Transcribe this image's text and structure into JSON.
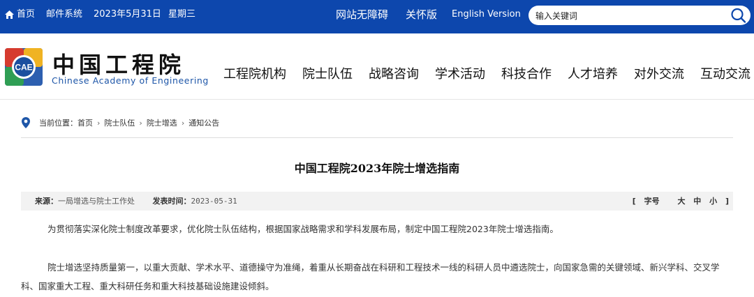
{
  "topbar": {
    "home": "首页",
    "mail": "邮件系统",
    "date": "2023年5月31日",
    "weekday": "星期三",
    "accessible": "网站无障碍",
    "care": "关怀版",
    "english": "English Version",
    "search_placeholder": "输入关键词"
  },
  "header": {
    "logo_cn": "中国工程院",
    "logo_en": "Chinese Academy of Engineering",
    "emblem_text": "CAE",
    "nav": [
      "工程院机构",
      "院士队伍",
      "战略咨询",
      "学术活动",
      "科技合作",
      "人才培养",
      "对外交流",
      "互动交流"
    ]
  },
  "breadcrumb": {
    "prefix": "当前位置：",
    "items": [
      "首页",
      "院士队伍",
      "院士增选",
      "通知公告"
    ]
  },
  "article": {
    "title": "中国工程院2023年院士增选指南",
    "source_label": "来源：",
    "source": "一局增选与院士工作处",
    "date_label": "发表时间：",
    "date": "2023-05-31",
    "font_label": "字号",
    "font_sizes": [
      "大",
      "中",
      "小"
    ],
    "bracket_open": "[",
    "bracket_close": "]",
    "paragraphs": [
      "为贯彻落实深化院士制度改革要求，优化院士队伍结构，根据国家战略需求和学科发展布局，制定中国工程院2023年院士增选指南。",
      "院士增选坚持质量第一，以重大贡献、学术水平、道德操守为准绳，着重从长期奋战在科研和工程技术一线的科研人员中遴选院士，向国家急需的关键领域、新兴学科、交叉学科、国家重大工程、重大科研任务和重大科技基础设施建设倾斜。"
    ]
  },
  "colors": {
    "topbar_bg": "#0d47ad",
    "logo_en": "#1e56a8",
    "meta_bg": "#f2f2f2"
  }
}
